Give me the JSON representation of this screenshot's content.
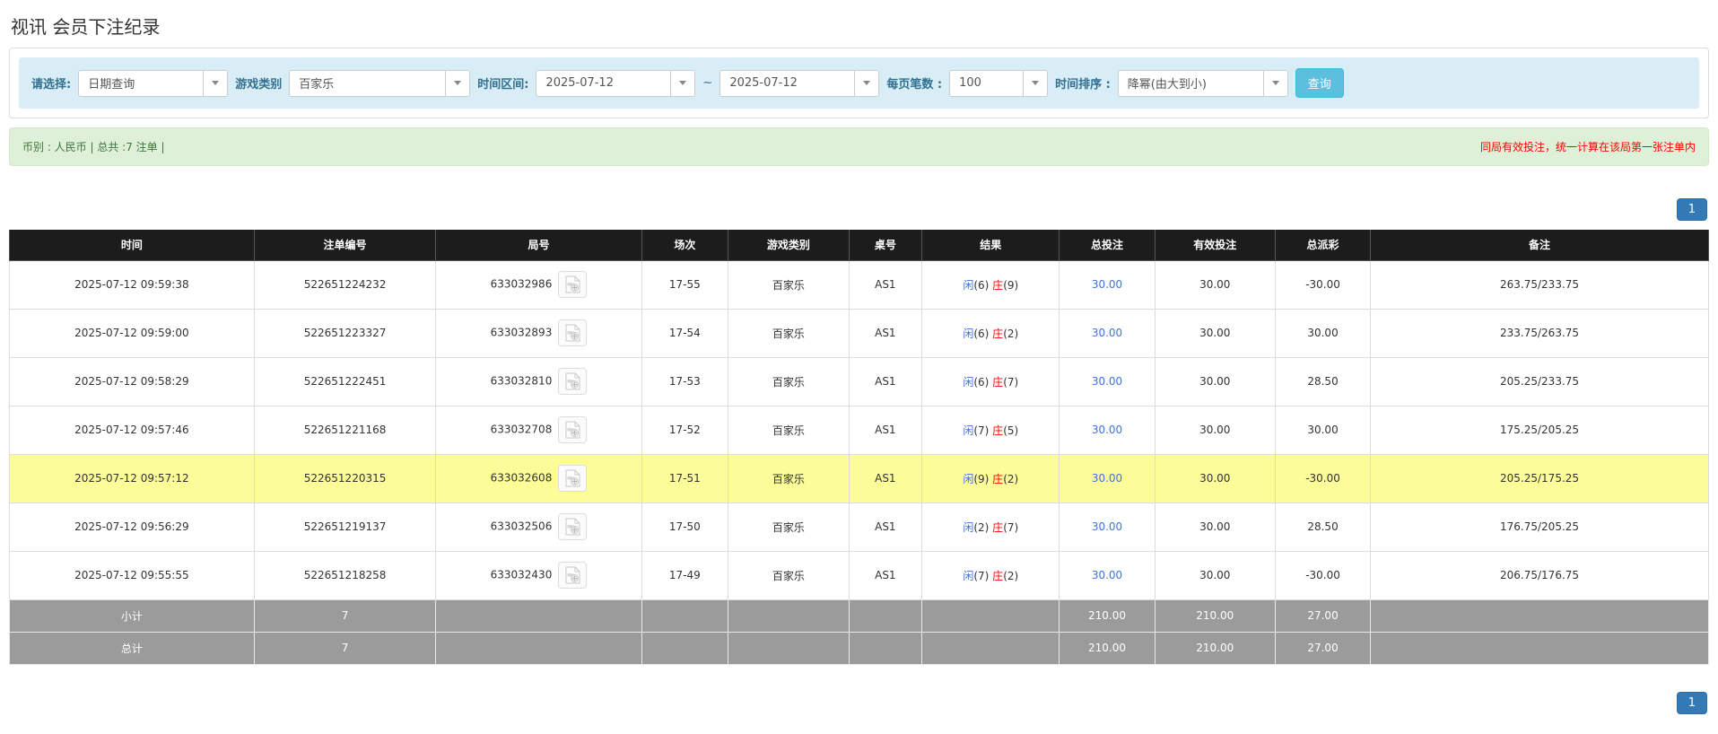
{
  "page": {
    "title": "视讯 会员下注纪录"
  },
  "filters": {
    "query_type_label": "请选择:",
    "query_type_value": "日期查询",
    "game_type_label": "游戏类别",
    "game_type_value": "百家乐",
    "date_range_label": "时间区间:",
    "date_from": "2025-07-12",
    "date_separator": "~",
    "date_to": "2025-07-12",
    "page_size_label": "每页笔数 :",
    "page_size_value": "100",
    "order_label": "时间排序 :",
    "order_value": "降幂(由大到小)",
    "search_button": "查询"
  },
  "info_bar": {
    "summary_text": "币别 : 人民币 | 总共 :7 注单 |",
    "warning_text": "同局有效投注，统一计算在该局第一张注单内"
  },
  "pagination": {
    "page": "1"
  },
  "icons": {
    "dropdown": "chevron-down-icon",
    "video": "video-file-icon"
  },
  "colors": {
    "accent_blue": "#3d74e0",
    "banker_red": "#ff0000",
    "negative_red": "#ff0000",
    "highlight_yellow": "#fcfc99",
    "header_black": "#1c1c1c",
    "summary_gray": "#9b9b9b",
    "filter_bar_blue": "#d9edf7",
    "info_green_bg": "#dff0d8",
    "info_green_text": "#3c763d",
    "search_button_blue": "#5bc0de",
    "pagination_blue": "#337ab7"
  },
  "table": {
    "headers": [
      "时间",
      "注单编号",
      "局号",
      "场次",
      "游戏类别",
      "桌号",
      "结果",
      "总投注",
      "有效投注",
      "总派彩",
      "备注"
    ],
    "rows": [
      {
        "time": "2025-07-12 09:59:38",
        "bet_id": "522651224232",
        "round_id": "633032986",
        "session": "17-55",
        "game": "百家乐",
        "table_no": "AS1",
        "result": {
          "player_label": "闲",
          "player_value": "(6)",
          "banker_label": "庄",
          "banker_value": "(9)"
        },
        "total_bet": "30.00",
        "valid_bet": "30.00",
        "payout": "-30.00",
        "note": "263.75/233.75"
      },
      {
        "time": "2025-07-12 09:59:00",
        "bet_id": "522651223327",
        "round_id": "633032893",
        "session": "17-54",
        "game": "百家乐",
        "table_no": "AS1",
        "result": {
          "player_label": "闲",
          "player_value": "(6)",
          "banker_label": "庄",
          "banker_value": "(2)"
        },
        "total_bet": "30.00",
        "valid_bet": "30.00",
        "payout": "30.00",
        "note": "233.75/263.75"
      },
      {
        "time": "2025-07-12 09:58:29",
        "bet_id": "522651222451",
        "round_id": "633032810",
        "session": "17-53",
        "game": "百家乐",
        "table_no": "AS1",
        "result": {
          "player_label": "闲",
          "player_value": "(6)",
          "banker_label": "庄",
          "banker_value": "(7)"
        },
        "total_bet": "30.00",
        "valid_bet": "30.00",
        "payout": "28.50",
        "note": "205.25/233.75"
      },
      {
        "time": "2025-07-12 09:57:46",
        "bet_id": "522651221168",
        "round_id": "633032708",
        "session": "17-52",
        "game": "百家乐",
        "table_no": "AS1",
        "result": {
          "player_label": "闲",
          "player_value": "(7)",
          "banker_label": "庄",
          "banker_value": "(5)"
        },
        "total_bet": "30.00",
        "valid_bet": "30.00",
        "payout": "30.00",
        "note": "175.25/205.25"
      },
      {
        "time": "2025-07-12 09:57:12",
        "bet_id": "522651220315",
        "round_id": "633032608",
        "session": "17-51",
        "game": "百家乐",
        "table_no": "AS1",
        "result": {
          "player_label": "闲",
          "player_value": "(9)",
          "banker_label": "庄",
          "banker_value": "(2)"
        },
        "total_bet": "30.00",
        "valid_bet": "30.00",
        "payout": "-30.00",
        "note": "205.25/175.25"
      },
      {
        "time": "2025-07-12 09:56:29",
        "bet_id": "522651219137",
        "round_id": "633032506",
        "session": "17-50",
        "game": "百家乐",
        "table_no": "AS1",
        "result": {
          "player_label": "闲",
          "player_value": "(2)",
          "banker_label": "庄",
          "banker_value": "(7)"
        },
        "total_bet": "30.00",
        "valid_bet": "30.00",
        "payout": "28.50",
        "note": "176.75/205.25"
      },
      {
        "time": "2025-07-12 09:55:55",
        "bet_id": "522651218258",
        "round_id": "633032430",
        "session": "17-49",
        "game": "百家乐",
        "table_no": "AS1",
        "result": {
          "player_label": "闲",
          "player_value": "(7)",
          "banker_label": "庄",
          "banker_value": "(2)"
        },
        "total_bet": "30.00",
        "valid_bet": "30.00",
        "payout": "-30.00",
        "note": "206.75/176.75"
      }
    ],
    "subtotal": {
      "label": "小计",
      "count": "7",
      "total_bet": "210.00",
      "valid_bet": "210.00",
      "payout": "27.00"
    },
    "total": {
      "label": "总计",
      "count": "7",
      "total_bet": "210.00",
      "valid_bet": "210.00",
      "payout": "27.00"
    }
  }
}
